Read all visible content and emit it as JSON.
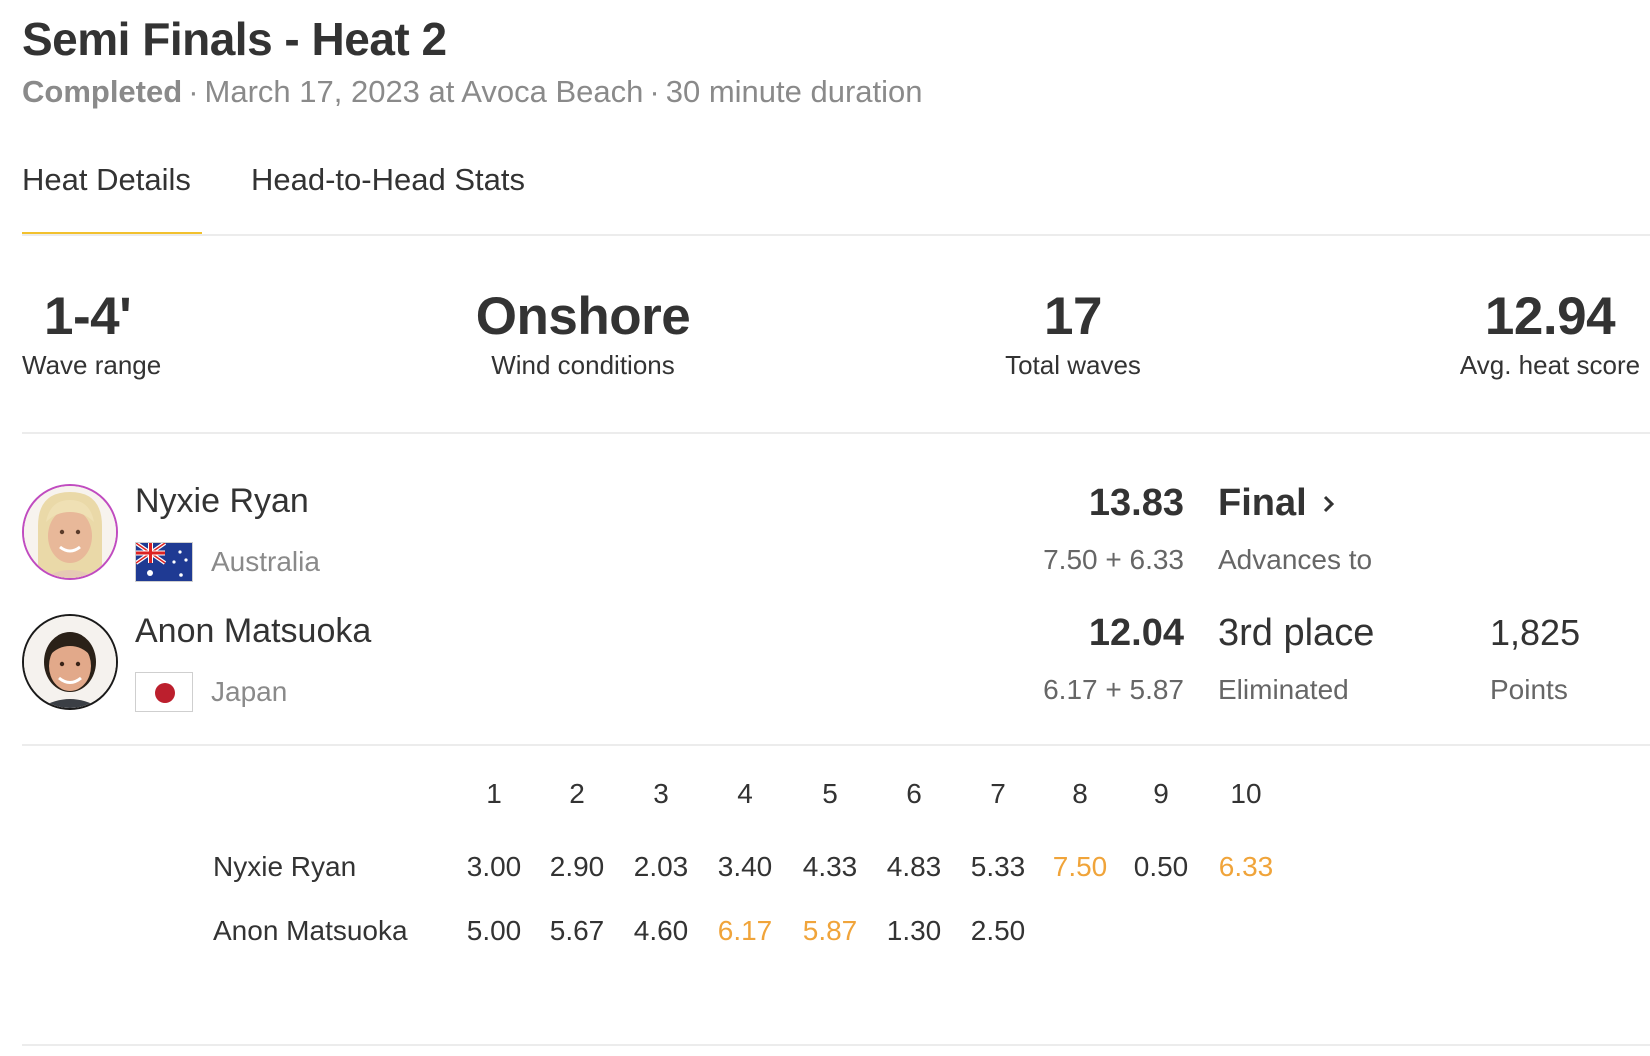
{
  "header": {
    "title": "Semi Finals - Heat 2",
    "status": "Completed",
    "separator": "·",
    "date_location": "March 17, 2023 at Avoca Beach",
    "duration": "30 minute duration"
  },
  "tabs": [
    {
      "label": "Heat Details",
      "active": true
    },
    {
      "label": "Head-to-Head Stats",
      "active": false
    }
  ],
  "accent_color": "#f2c12e",
  "highlight_color": "#f0a43a",
  "stats": [
    {
      "value": "1-4'",
      "label": "Wave range"
    },
    {
      "value": "Onshore",
      "label": "Wind conditions"
    },
    {
      "value": "17",
      "label": "Total waves"
    },
    {
      "value": "12.94",
      "label": "Avg. heat score"
    }
  ],
  "athletes": [
    {
      "name": "Nyxie Ryan",
      "country": "Australia",
      "flag_icon": "australia-flag-icon",
      "avatar_border": "#c04bc0",
      "total": "13.83",
      "best_waves": "7.50 + 6.33",
      "result": "Final",
      "result_sub": "Advances to"
    },
    {
      "name": "Anon Matsuoka",
      "country": "Japan",
      "flag_icon": "japan-flag-icon",
      "avatar_border": "#1a1a1a",
      "total": "12.04",
      "best_waves": "6.17 + 5.87",
      "result": "3rd place",
      "result_sub": "Eliminated",
      "points": "1,825",
      "points_label": "Points"
    }
  ],
  "wave_table": {
    "headers": [
      "1",
      "2",
      "3",
      "4",
      "5",
      "6",
      "7",
      "8",
      "9",
      "10"
    ],
    "rows": [
      {
        "name": "Nyxie Ryan",
        "scores": [
          "3.00",
          "2.90",
          "2.03",
          "3.40",
          "4.33",
          "4.83",
          "5.33",
          "7.50",
          "0.50",
          "6.33"
        ],
        "counted": [
          false,
          false,
          false,
          false,
          false,
          false,
          false,
          true,
          false,
          true
        ]
      },
      {
        "name": "Anon Matsuoka",
        "scores": [
          "5.00",
          "5.67",
          "4.60",
          "6.17",
          "5.87",
          "1.30",
          "2.50"
        ],
        "counted": [
          false,
          false,
          false,
          true,
          true,
          false,
          false
        ]
      }
    ]
  }
}
